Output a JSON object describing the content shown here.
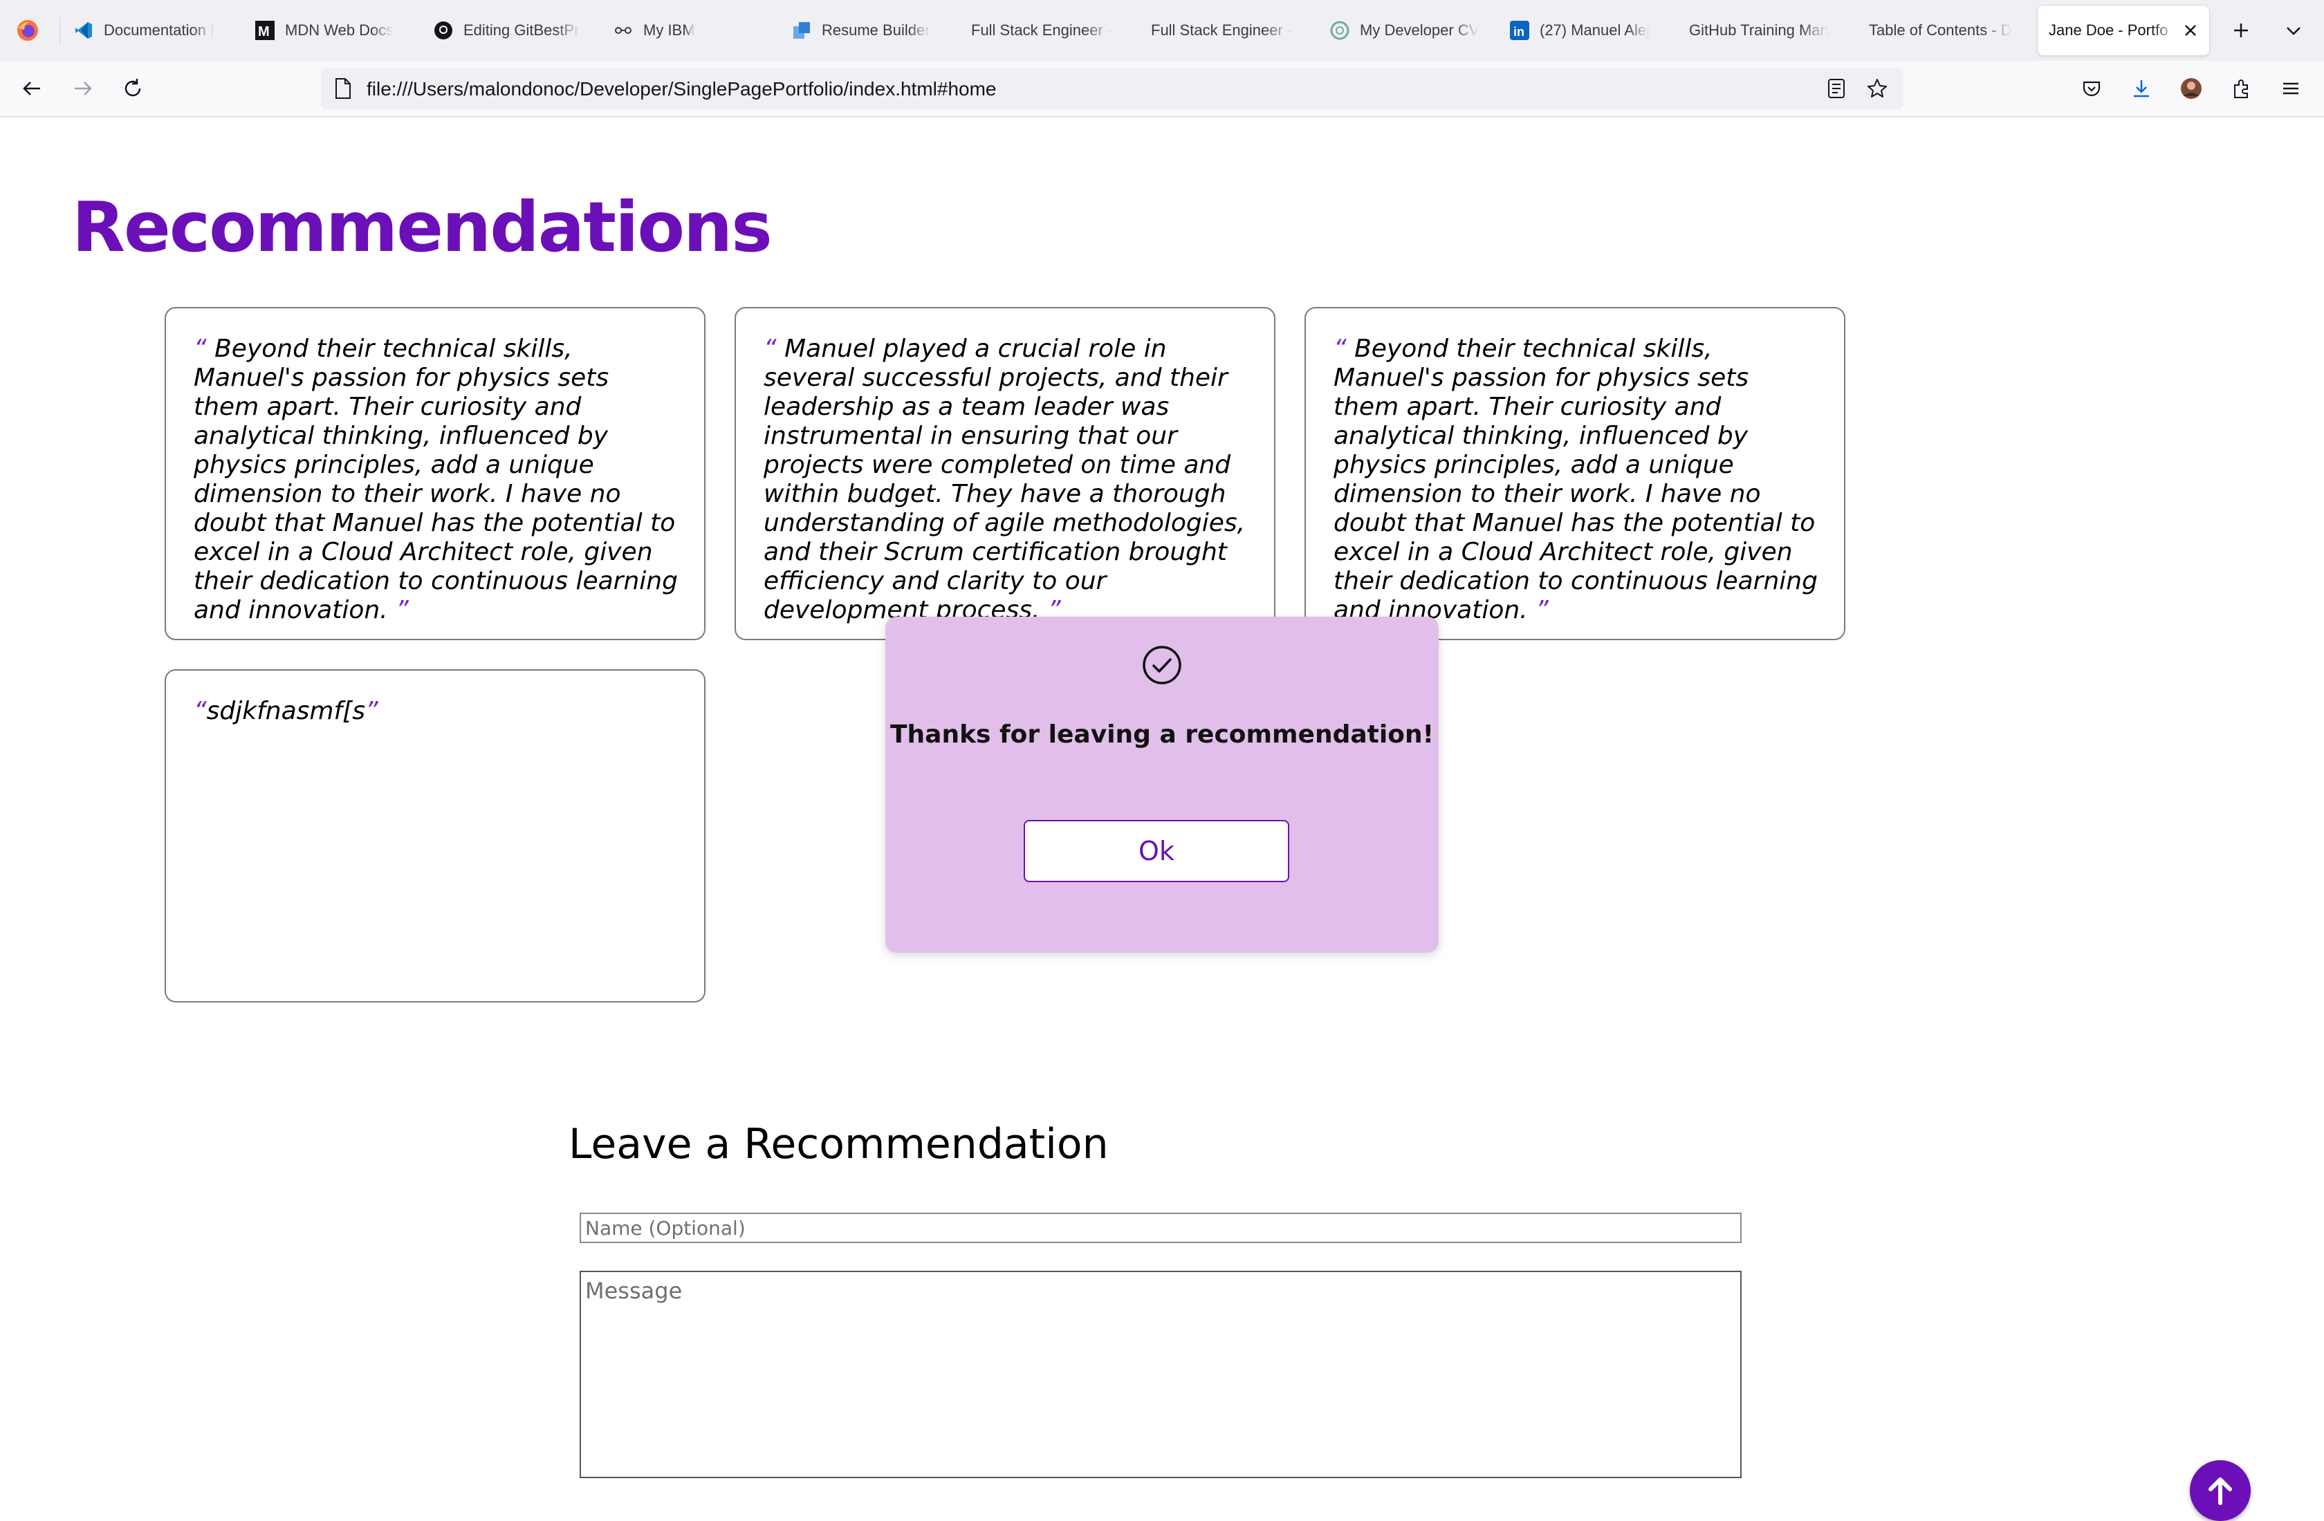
{
  "browser": {
    "tabs": [
      {
        "title": "Documentation |",
        "icon": "vscode-icon"
      },
      {
        "title": "MDN Web Docs",
        "icon": "mdn-icon"
      },
      {
        "title": "Editing GitBestPr",
        "icon": "github-icon"
      },
      {
        "title": "My IBM",
        "icon": "ibm-icon"
      },
      {
        "title": "Resume Builder",
        "icon": "resume-builder-icon"
      },
      {
        "title": "Full Stack Engineer -",
        "icon": ""
      },
      {
        "title": "Full Stack Engineer -",
        "icon": ""
      },
      {
        "title": "My Developer CV",
        "icon": "chatgpt-icon"
      },
      {
        "title": "(27) Manuel Alej",
        "icon": "linkedin-icon"
      },
      {
        "title": "GitHub Training Man",
        "icon": ""
      },
      {
        "title": "Table of Contents - D",
        "icon": ""
      },
      {
        "title": "Jane Doe - Portfo",
        "icon": "",
        "active": true
      }
    ],
    "url": "file:///Users/malondonoc/Developer/SinglePagePortfolio/index.html#home"
  },
  "page": {
    "title": "Recommendations",
    "recommendations": [
      {
        "open_quote": "“",
        "text": "Beyond their technical skills, Manuel's passion for physics sets them apart. Their curiosity and analytical thinking, influenced by physics principles, add a unique dimension to their work. I have no doubt that Manuel has the potential to excel in a Cloud Architect role, given their dedication to continuous learning and innovation.",
        "close_quote": "”"
      },
      {
        "open_quote": "“",
        "text": "Manuel played a crucial role in several successful projects, and their leadership as a team leader was instrumental in ensuring that our projects were completed on time and within budget. They have a thorough understanding of agile methodologies, and their Scrum certification brought efficiency and clarity to our development process.",
        "close_quote": "”"
      },
      {
        "open_quote": "“",
        "text": "Beyond their technical skills, Manuel's passion for physics sets them apart. Their curiosity and analytical thinking, influenced by physics principles, add a unique dimension to their work. I have no doubt that Manuel has the potential to excel in a Cloud Architect role, given their dedication to continuous learning and innovation.",
        "close_quote": "”"
      },
      {
        "open_quote": "“",
        "text": "sdjkfnasmf[s",
        "close_quote": "”"
      }
    ],
    "modal": {
      "message": "Thanks for leaving a recommendation!",
      "ok_label": "Ok",
      "icon": "check-circle-icon"
    },
    "form": {
      "title": "Leave a Recommendation",
      "name_placeholder": "Name (Optional)",
      "message_placeholder": "Message"
    },
    "scroll_top_icon": "arrow-up-icon"
  },
  "colors": {
    "accent": "#6b0fb8",
    "modal_bg": "#e1bfea",
    "quote": "#7a1fd0"
  }
}
